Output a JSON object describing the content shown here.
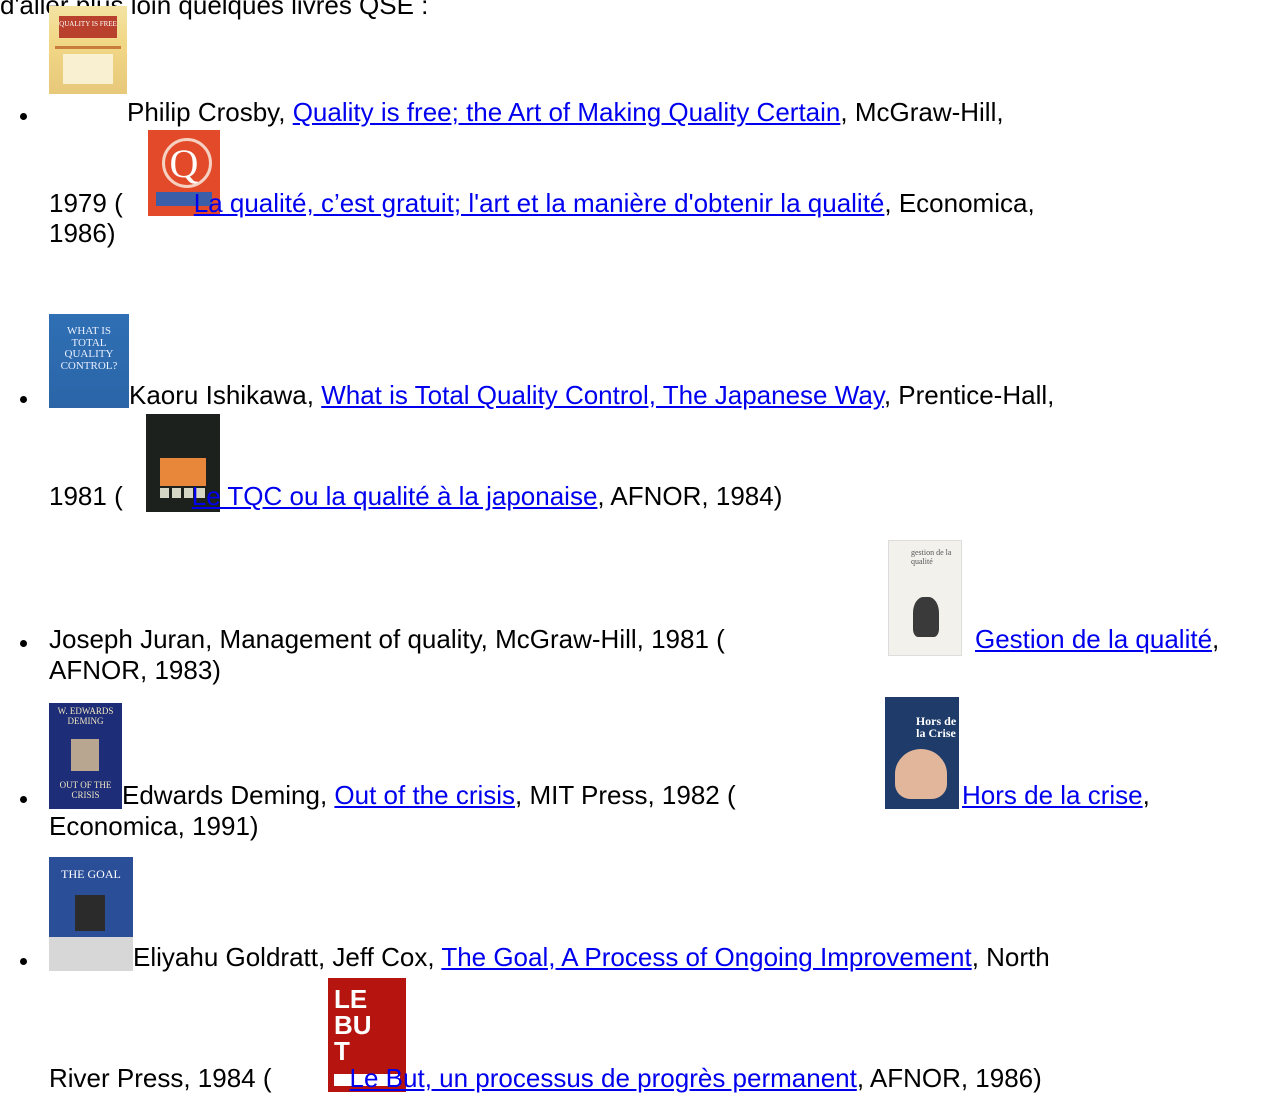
{
  "intro_text": "d'aller plus loin quelques livres QSE :",
  "books": [
    {
      "author": "Philip Crosby, ",
      "title": "Quality is free; the Art of Making Quality Certain",
      "details": ", McGraw-Hill,",
      "year": "1979 (",
      "fr_title": "La qualité, c’est gratuit; l'art et la manière d'obtenir la qualité",
      "fr_details": ", Economica,",
      "fr_year": "1986)"
    },
    {
      "author": "Kaoru Ishikawa, ",
      "title": "What is Total Quality Control, The Japanese Way",
      "details": ", Prentice-Hall,",
      "year": "1981 (",
      "fr_title": "Le TQC ou la qualité à la japonaise",
      "fr_details": ", AFNOR, 1984)"
    },
    {
      "text": "Joseph Juran, Management of quality, McGraw-Hill, 1981 (",
      "fr_title": "Gestion de la qualité",
      "fr_details": ",",
      "fr_line2": "AFNOR, 1983)"
    },
    {
      "author": "Edwards Deming, ",
      "title": "Out of the crisis",
      "details": ", MIT Press, 1982 (",
      "fr_title": "Hors de la crise",
      "fr_details": ",",
      "fr_line2": "Economica, 1991)"
    },
    {
      "author": "Eliyahu Goldratt, Jeff Cox, ",
      "title": "The Goal, A Process of Ongoing Improvement",
      "details": ", North",
      "line2": "River Press, 1984 (",
      "fr_title": "Le But, un processus de progrès permanent",
      "fr_details": ", AFNOR, 1986)"
    }
  ],
  "covers": {
    "crosby_en": "QUALITY IS FREE",
    "crosby_fr": "Q",
    "ishikawa_en": "WHAT IS TOTAL QUALITY CONTROL?",
    "juran_fr": "gestion de la qualité",
    "deming_en_top": "W. EDWARDS DEMING",
    "deming_en_bottom": "OUT OF THE CRISIS",
    "deming_fr": "Hors de la Crise",
    "goal_en": "THE GOAL",
    "but_fr": "LE BUT"
  }
}
